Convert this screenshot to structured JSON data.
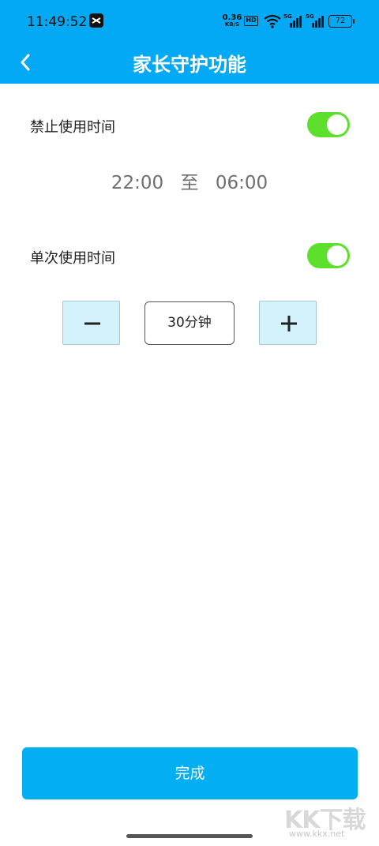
{
  "status_bar": {
    "time": "11:49:52",
    "net_speed_value": "0.36",
    "net_speed_unit": "KB/S",
    "hd_label": "HD",
    "signal1_label": "5G",
    "signal2_label": "5G",
    "battery": "72",
    "icons": [
      "capcut-app-icon",
      "wifi-icon",
      "signal-icon",
      "signal-icon",
      "battery-icon"
    ]
  },
  "header": {
    "title": "家长守护功能",
    "back_icon": "chevron-left-icon"
  },
  "ban_time": {
    "label": "禁止使用时间",
    "enabled": true,
    "start": "22:00",
    "separator": "至",
    "end": "06:00"
  },
  "session_time": {
    "label": "单次使用时间",
    "enabled": true,
    "value": "30分钟",
    "decrement_icon": "minus-icon",
    "increment_icon": "plus-icon"
  },
  "footer": {
    "done_label": "完成"
  },
  "watermark": {
    "logo": "KK下载",
    "url": "www.kkx.net"
  },
  "colors": {
    "header_bg": "#03a9f4",
    "toggle_on": "#5ce02c",
    "stepper_bg": "#d3f2fc",
    "done_bg": "#03aef2"
  }
}
